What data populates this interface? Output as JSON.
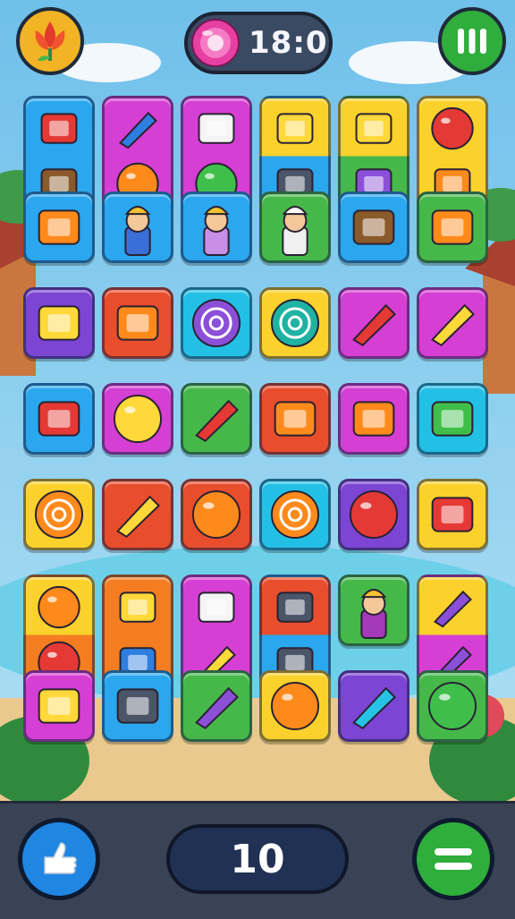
{
  "hud": {
    "timer": "18:0",
    "moves": "10"
  },
  "icons": {
    "top_left": "flower-bud-icon",
    "timer": "candy-icon",
    "top_right": "pause-icon",
    "bottom_left": "thumbs-up-hand-icon",
    "bottom_right": "menu-icon"
  },
  "colors": {
    "blue": "#2aa7ee",
    "magenta": "#d63fd3",
    "purple": "#7c45d3",
    "yellow": "#fbd22c",
    "green": "#46b84a",
    "orange": "#f47d21",
    "red": "#e84d2c",
    "cyan": "#23c0e6"
  },
  "board": {
    "rows": 7,
    "cols": 6,
    "tiles": [
      {
        "r": 0,
        "c": 0,
        "top": "blue",
        "bottom": "blue",
        "icons": [
          "red-leaf-icon",
          "photo-frame-icon"
        ]
      },
      {
        "r": 0,
        "c": 1,
        "top": "magenta",
        "bottom": "magenta",
        "icons": [
          "blue-kite-icon",
          "orange-pendant-icon"
        ]
      },
      {
        "r": 0,
        "c": 2,
        "top": "magenta",
        "bottom": "magenta",
        "icons": [
          "white-gem-icon",
          "green-apple-icon"
        ]
      },
      {
        "r": 0,
        "c": 3,
        "top": "yellow",
        "bottom": "blue",
        "icons": [
          "cheese-piece-icon",
          "camera-icon"
        ]
      },
      {
        "r": 0,
        "c": 4,
        "top": "yellow",
        "bottom": "green",
        "icons": [
          "wing-icon",
          "purple-eraser-icon"
        ]
      },
      {
        "r": 0,
        "c": 5,
        "top": "yellow",
        "bottom": "yellow",
        "icons": [
          "red-heart-fruit-icon",
          "phone-card-icon"
        ]
      },
      {
        "r": 1,
        "c": 0,
        "top": "blue",
        "bottom": "blue",
        "icons": [
          "potted-flower-icon"
        ]
      },
      {
        "r": 1,
        "c": 1,
        "top": "blue",
        "bottom": "blue",
        "icons": [
          "girl-character-icon"
        ]
      },
      {
        "r": 1,
        "c": 2,
        "top": "blue",
        "bottom": "blue",
        "icons": [
          "wizard-character-icon"
        ]
      },
      {
        "r": 1,
        "c": 3,
        "top": "green",
        "bottom": "green",
        "icons": [
          "grandma-character-icon"
        ]
      },
      {
        "r": 1,
        "c": 4,
        "top": "blue",
        "bottom": "blue",
        "icons": [
          "crown-chocolate-icon"
        ]
      },
      {
        "r": 1,
        "c": 5,
        "top": "green",
        "bottom": "green",
        "icons": [
          "calendar-paint-icon"
        ]
      },
      {
        "r": 2,
        "c": 0,
        "top": "purple",
        "bottom": "purple",
        "icons": [
          "yellow-bulb-icon"
        ]
      },
      {
        "r": 2,
        "c": 1,
        "top": "red",
        "bottom": "red",
        "icons": [
          "orange-bean-icon"
        ]
      },
      {
        "r": 2,
        "c": 2,
        "top": "cyan",
        "bottom": "cyan",
        "icons": [
          "purple-swirl-icon"
        ]
      },
      {
        "r": 2,
        "c": 3,
        "top": "yellow",
        "bottom": "yellow",
        "icons": [
          "teal-swirl-icon"
        ]
      },
      {
        "r": 2,
        "c": 4,
        "top": "magenta",
        "bottom": "magenta",
        "icons": [
          "red-crayon-icon"
        ]
      },
      {
        "r": 2,
        "c": 5,
        "top": "magenta",
        "bottom": "magenta",
        "icons": [
          "yellow-crayon-icon"
        ]
      },
      {
        "r": 3,
        "c": 0,
        "top": "blue",
        "bottom": "blue",
        "icons": [
          "red-bud-icon"
        ]
      },
      {
        "r": 3,
        "c": 1,
        "top": "magenta",
        "bottom": "magenta",
        "icons": [
          "yellow-egg-icon"
        ]
      },
      {
        "r": 3,
        "c": 2,
        "top": "green",
        "bottom": "green",
        "icons": [
          "red-marker-icon"
        ]
      },
      {
        "r": 3,
        "c": 3,
        "top": "red",
        "bottom": "red",
        "icons": [
          "calendar-grid-icon"
        ]
      },
      {
        "r": 3,
        "c": 4,
        "top": "magenta",
        "bottom": "magenta",
        "icons": [
          "microwave-icon"
        ]
      },
      {
        "r": 3,
        "c": 5,
        "top": "cyan",
        "bottom": "cyan",
        "icons": [
          "green-book-icon"
        ]
      },
      {
        "r": 4,
        "c": 0,
        "top": "yellow",
        "bottom": "yellow",
        "icons": [
          "rainbow-swirl-icon"
        ]
      },
      {
        "r": 4,
        "c": 1,
        "top": "red",
        "bottom": "red",
        "icons": [
          "cheese-wedge-icon"
        ]
      },
      {
        "r": 4,
        "c": 2,
        "top": "red",
        "bottom": "red",
        "icons": [
          "orange-bear-icon"
        ]
      },
      {
        "r": 4,
        "c": 3,
        "top": "cyan",
        "bottom": "cyan",
        "icons": [
          "lollipop-swirl-icon"
        ]
      },
      {
        "r": 4,
        "c": 4,
        "top": "purple",
        "bottom": "purple",
        "icons": [
          "red-sun-icon"
        ]
      },
      {
        "r": 4,
        "c": 5,
        "top": "yellow",
        "bottom": "yellow",
        "icons": [
          "red-button-device-icon"
        ]
      },
      {
        "r": 5,
        "c": 0,
        "top": "yellow",
        "bottom": "orange",
        "icons": [
          "strawberry-icon",
          "red-balloon-icon"
        ]
      },
      {
        "r": 5,
        "c": 1,
        "top": "orange",
        "bottom": "orange",
        "icons": [
          "potato-icon",
          "blue-gear-icon"
        ]
      },
      {
        "r": 5,
        "c": 2,
        "top": "magenta",
        "bottom": "magenta",
        "icons": [
          "white-grid-box-icon",
          "yellow-key-icon"
        ]
      },
      {
        "r": 5,
        "c": 3,
        "top": "red",
        "bottom": "blue",
        "icons": [
          "tv-screen-icon",
          "trash-bucket-icon"
        ]
      },
      {
        "r": 5,
        "c": 4,
        "top": "green",
        "bottom": "green",
        "icons": [
          "boy-character-icon"
        ]
      },
      {
        "r": 5,
        "c": 5,
        "top": "yellow",
        "bottom": "magenta",
        "icons": [
          "purple-marker-icon",
          "purple-wedge-icon"
        ]
      },
      {
        "r": 6,
        "c": 0,
        "top": "magenta",
        "bottom": "magenta",
        "icons": [
          "yellow-bottle-icon"
        ]
      },
      {
        "r": 6,
        "c": 1,
        "top": "blue",
        "bottom": "blue",
        "icons": [
          "tin-can-icon"
        ]
      },
      {
        "r": 6,
        "c": 2,
        "top": "green",
        "bottom": "green",
        "icons": [
          "purple-shovel-icon"
        ]
      },
      {
        "r": 6,
        "c": 3,
        "top": "yellow",
        "bottom": "yellow",
        "icons": [
          "orange-blob-icon"
        ]
      },
      {
        "r": 6,
        "c": 4,
        "top": "purple",
        "bottom": "purple",
        "icons": [
          "cyan-cone-icon"
        ]
      },
      {
        "r": 6,
        "c": 5,
        "top": "green",
        "bottom": "green",
        "icons": [
          "green-blob-icon"
        ]
      }
    ]
  }
}
